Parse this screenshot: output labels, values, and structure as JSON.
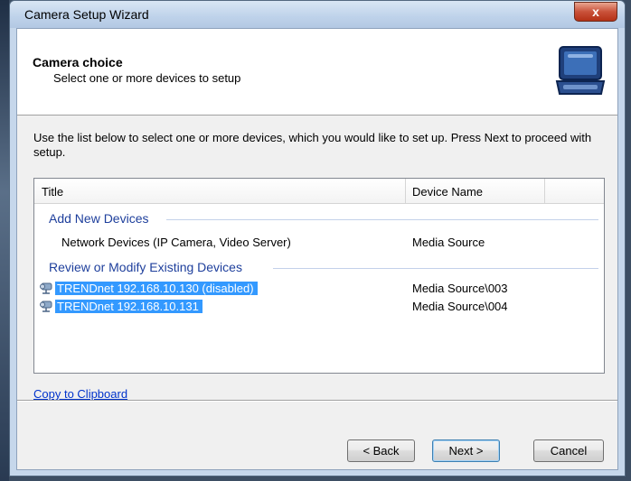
{
  "window": {
    "title": "Camera Setup Wizard",
    "close_glyph": "x"
  },
  "header": {
    "title": "Camera choice",
    "subtitle": "Select one or more devices to setup",
    "icon": "camera-case-icon"
  },
  "instructions": "Use the list below to select one or more devices, which you would like to set up. Press Next to proceed with setup.",
  "list": {
    "columns": [
      "Title",
      "Device Name"
    ],
    "groups": [
      {
        "label": "Add New Devices",
        "items": [
          {
            "title": "Network Devices (IP Camera, Video Server)",
            "device": "Media Source",
            "selected": false
          }
        ]
      },
      {
        "label": "Review or Modify Existing Devices",
        "items": [
          {
            "title": "TRENDnet 192.168.10.130 (disabled)",
            "device": "Media Source\\003",
            "selected": true,
            "icon": "camera-icon"
          },
          {
            "title": "TRENDnet 192.168.10.131",
            "device": "Media Source\\004",
            "selected": true,
            "icon": "camera-icon"
          }
        ]
      }
    ]
  },
  "clipboard_link": "Copy to Clipboard",
  "buttons": {
    "back": "< Back",
    "next": "Next >",
    "cancel": "Cancel"
  },
  "colors": {
    "accent": "#1e3f9c",
    "selection": "#3399ff",
    "link": "#0033cc"
  }
}
